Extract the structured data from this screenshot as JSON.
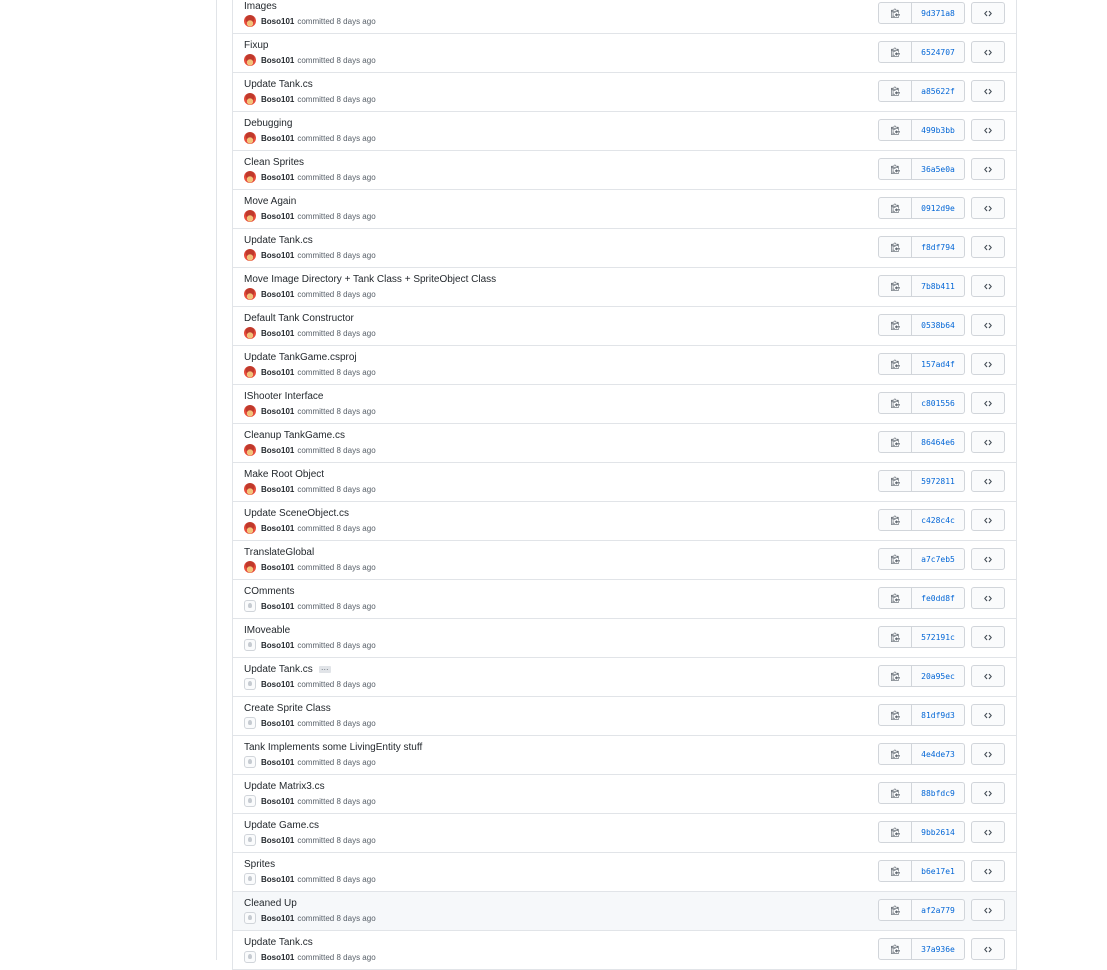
{
  "commits": [
    {
      "message": "Images",
      "author": "Boso101",
      "action": "committed",
      "time": "8 days ago",
      "sha": "9d371a8",
      "avatar": "photo"
    },
    {
      "message": "Fixup",
      "author": "Boso101",
      "action": "committed",
      "time": "8 days ago",
      "sha": "6524707",
      "avatar": "photo"
    },
    {
      "message": "Update Tank.cs",
      "author": "Boso101",
      "action": "committed",
      "time": "8 days ago",
      "sha": "a85622f",
      "avatar": "photo"
    },
    {
      "message": "Debugging",
      "author": "Boso101",
      "action": "committed",
      "time": "8 days ago",
      "sha": "499b3bb",
      "avatar": "photo"
    },
    {
      "message": "Clean Sprites",
      "author": "Boso101",
      "action": "committed",
      "time": "8 days ago",
      "sha": "36a5e0a",
      "avatar": "photo"
    },
    {
      "message": "Move Again",
      "author": "Boso101",
      "action": "committed",
      "time": "8 days ago",
      "sha": "0912d9e",
      "avatar": "photo"
    },
    {
      "message": "Update Tank.cs",
      "author": "Boso101",
      "action": "committed",
      "time": "8 days ago",
      "sha": "f8df794",
      "avatar": "photo"
    },
    {
      "message": "Move Image Directory + Tank Class + SpriteObject Class",
      "author": "Boso101",
      "action": "committed",
      "time": "8 days ago",
      "sha": "7b8b411",
      "avatar": "photo"
    },
    {
      "message": "Default Tank Constructor",
      "author": "Boso101",
      "action": "committed",
      "time": "8 days ago",
      "sha": "0538b64",
      "avatar": "photo"
    },
    {
      "message": "Update TankGame.csproj",
      "author": "Boso101",
      "action": "committed",
      "time": "8 days ago",
      "sha": "157ad4f",
      "avatar": "photo"
    },
    {
      "message": "IShooter Interface",
      "author": "Boso101",
      "action": "committed",
      "time": "8 days ago",
      "sha": "c801556",
      "avatar": "photo"
    },
    {
      "message": "Cleanup TankGame.cs",
      "author": "Boso101",
      "action": "committed",
      "time": "8 days ago",
      "sha": "86464e6",
      "avatar": "photo"
    },
    {
      "message": "Make Root Object",
      "author": "Boso101",
      "action": "committed",
      "time": "8 days ago",
      "sha": "5972811",
      "avatar": "photo"
    },
    {
      "message": "Update SceneObject.cs",
      "author": "Boso101",
      "action": "committed",
      "time": "8 days ago",
      "sha": "c428c4c",
      "avatar": "photo"
    },
    {
      "message": "TranslateGlobal",
      "author": "Boso101",
      "action": "committed",
      "time": "8 days ago",
      "sha": "a7c7eb5",
      "avatar": "photo"
    },
    {
      "message": "COmments",
      "author": "Boso101",
      "action": "committed",
      "time": "8 days ago",
      "sha": "fe0dd8f",
      "avatar": "default"
    },
    {
      "message": "IMoveable",
      "author": "Boso101",
      "action": "committed",
      "time": "8 days ago",
      "sha": "572191c",
      "avatar": "default"
    },
    {
      "message": "Update Tank.cs",
      "author": "Boso101",
      "action": "committed",
      "time": "8 days ago",
      "sha": "20a95ec",
      "avatar": "default",
      "has_more": true
    },
    {
      "message": "Create Sprite Class",
      "author": "Boso101",
      "action": "committed",
      "time": "8 days ago",
      "sha": "81df9d3",
      "avatar": "default"
    },
    {
      "message": "Tank Implements some LivingEntity stuff",
      "author": "Boso101",
      "action": "committed",
      "time": "8 days ago",
      "sha": "4e4de73",
      "avatar": "default"
    },
    {
      "message": "Update Matrix3.cs",
      "author": "Boso101",
      "action": "committed",
      "time": "8 days ago",
      "sha": "88bfdc9",
      "avatar": "default"
    },
    {
      "message": "Update Game.cs",
      "author": "Boso101",
      "action": "committed",
      "time": "8 days ago",
      "sha": "9bb2614",
      "avatar": "default"
    },
    {
      "message": "Sprites",
      "author": "Boso101",
      "action": "committed",
      "time": "8 days ago",
      "sha": "b6e17e1",
      "avatar": "default"
    },
    {
      "message": "Cleaned Up",
      "author": "Boso101",
      "action": "committed",
      "time": "8 days ago",
      "sha": "af2a779",
      "avatar": "default",
      "hover": true
    },
    {
      "message": "Update Tank.cs",
      "author": "Boso101",
      "action": "committed",
      "time": "8 days ago",
      "sha": "37a936e",
      "avatar": "default"
    }
  ],
  "ellipsis_label": "…",
  "icons": {
    "copy": "clipboard-icon",
    "browse": "code-icon"
  },
  "colors": {
    "sha_link": "#0366d6",
    "border": "#e1e4e8",
    "hover_row": "#f6f8fa"
  }
}
